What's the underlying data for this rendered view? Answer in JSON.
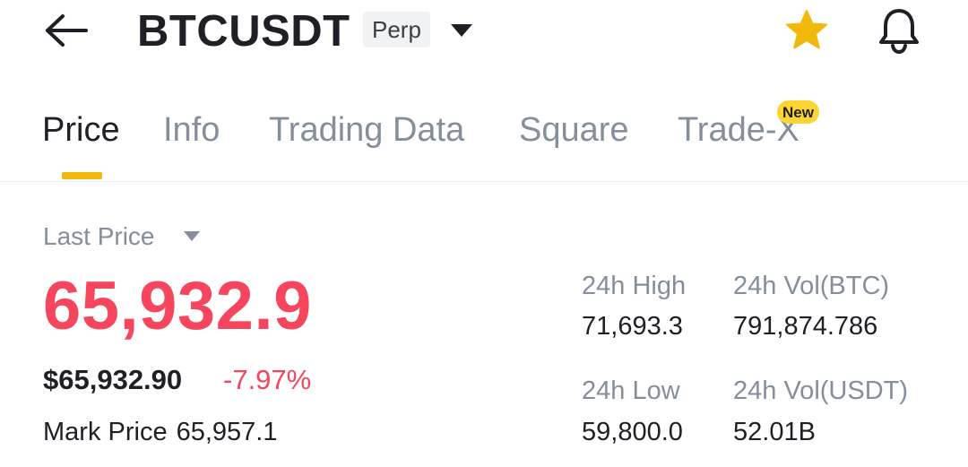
{
  "header": {
    "symbol": "BTCUSDT",
    "contract_type": "Perp",
    "icons": {
      "back": "arrow-left-icon",
      "dropdown": "caret-down-icon",
      "favorite": "star-icon",
      "alert": "bell-icon"
    },
    "colors": {
      "favorite": "#F0B90B"
    }
  },
  "tabs": [
    {
      "label": "Price",
      "active": true
    },
    {
      "label": "Info",
      "active": false
    },
    {
      "label": "Trading Data",
      "active": false
    },
    {
      "label": "Square",
      "active": false
    },
    {
      "label": "Trade-X",
      "active": false,
      "badge": "New"
    }
  ],
  "price": {
    "selector_label": "Last Price",
    "last_price": "65,932.9",
    "usd_price": "$65,932.90",
    "change_percent": "-7.97%",
    "mark_label": "Mark Price",
    "mark_value": "65,957.1"
  },
  "stats": {
    "high_label": "24h High",
    "high_value": "71,693.3",
    "vol_btc_label": "24h Vol(BTC)",
    "vol_btc_value": "791,874.786",
    "low_label": "24h Low",
    "low_value": "59,800.0",
    "vol_usdt_label": "24h Vol(USDT)",
    "vol_usdt_value": "52.01B"
  },
  "colors": {
    "accent": "#F0B90B",
    "negative": "#F6465D",
    "primary_text": "#1E2026",
    "secondary_text": "#848E9C"
  }
}
